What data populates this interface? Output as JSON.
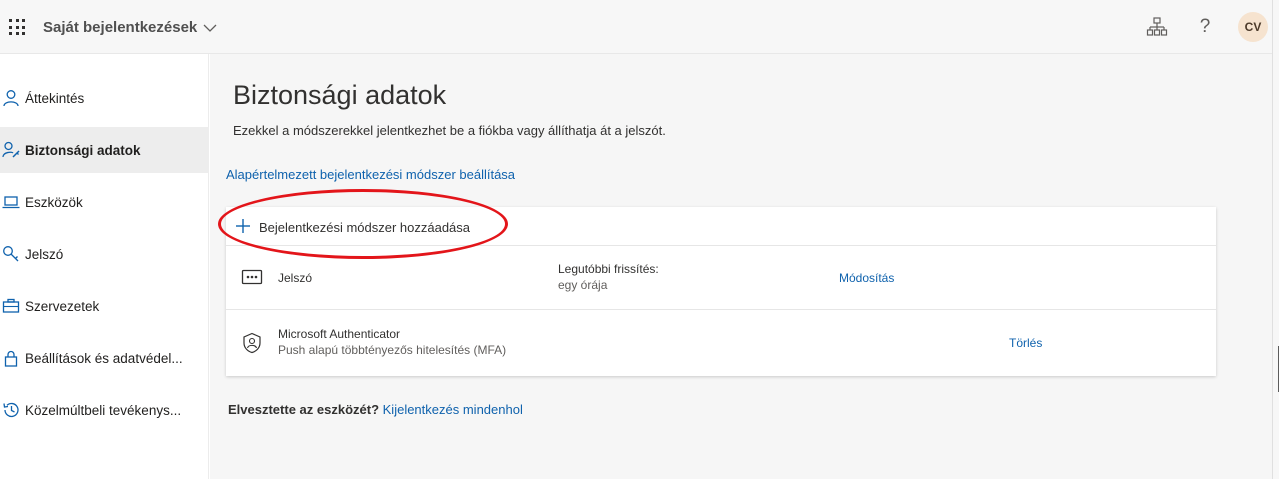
{
  "header": {
    "app_title": "Saját bejelentkezések",
    "help_glyph": "?",
    "avatar_initials": "CV",
    "icons": [
      "waffle-icon",
      "chevron-down-icon",
      "org-chart-icon",
      "help-icon"
    ]
  },
  "sidebar": {
    "items": [
      {
        "label": "Áttekintés",
        "icon": "person-icon",
        "active": false
      },
      {
        "label": "Biztonsági adatok",
        "icon": "person-key-icon",
        "active": true
      },
      {
        "label": "Eszközök",
        "icon": "laptop-icon",
        "active": false
      },
      {
        "label": "Jelszó",
        "icon": "key-icon",
        "active": false
      },
      {
        "label": "Szervezetek",
        "icon": "briefcase-icon",
        "active": false
      },
      {
        "label": "Beállítások és adatvédel...",
        "icon": "lock-icon",
        "active": false
      },
      {
        "label": "Közelmúltbeli tevékenys...",
        "icon": "history-icon",
        "active": false
      }
    ]
  },
  "main": {
    "title": "Biztonsági adatok",
    "description": "Ezekkel a módszerekkel jelentkezhet be a fiókba vagy állíthatja át a jelszót.",
    "default_method_link": "Alapértelmezett bejelentkezési módszer beállítása",
    "add_method_label": "Bejelentkezési módszer hozzáadása",
    "methods": [
      {
        "icon": "password-dots-icon",
        "name": "Jelszó",
        "detail_label": "Legutóbbi frissítés:",
        "detail_value": "egy órája",
        "action": "Módosítás"
      },
      {
        "icon": "authenticator-icon",
        "name": "Microsoft Authenticator",
        "subtitle": "Push alapú többtényezős hitelesítés (MFA)",
        "action": "Törlés"
      }
    ],
    "lost_device_question": "Elvesztette az eszközét?",
    "lost_device_link": "Kijelentkezés mindenhol"
  },
  "colors": {
    "accent_link": "#0f62ad",
    "annotation_red": "#e3151a",
    "avatar_bg": "#f6e3cf",
    "main_bg": "#f6f6f6"
  }
}
